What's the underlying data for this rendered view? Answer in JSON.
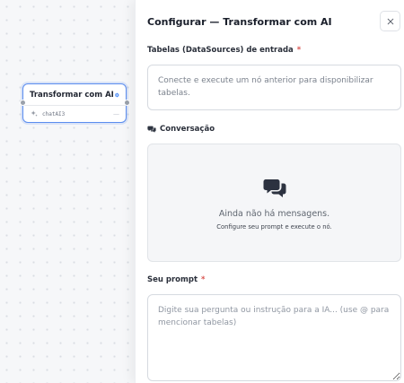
{
  "node": {
    "title": "Transformar com AI",
    "subtitle": "chatAI3",
    "gear_icon": "gear-icon",
    "ai_icon": "sparkles-icon",
    "collapse": "—"
  },
  "panel": {
    "title": "Configurar — Transformar com AI",
    "close_icon": "close-icon",
    "datasources": {
      "label": "Tabelas (DataSources) de entrada",
      "required": "*",
      "empty_text": "Conecte e execute um nó anterior para disponibilizar tabelas."
    },
    "conversation": {
      "label": "Conversação",
      "icon": "chat-bubbles-icon",
      "empty_title": "Ainda não há mensagens.",
      "empty_subtitle": "Configure seu prompt e execute o nó."
    },
    "prompt": {
      "label": "Seu prompt",
      "required": "*",
      "placeholder": "Digite sua pergunta ou instrução para a IA... (use @ para mencionar tabelas)",
      "value": ""
    }
  },
  "colors": {
    "accent": "#5b8def",
    "required": "#d9534f"
  }
}
